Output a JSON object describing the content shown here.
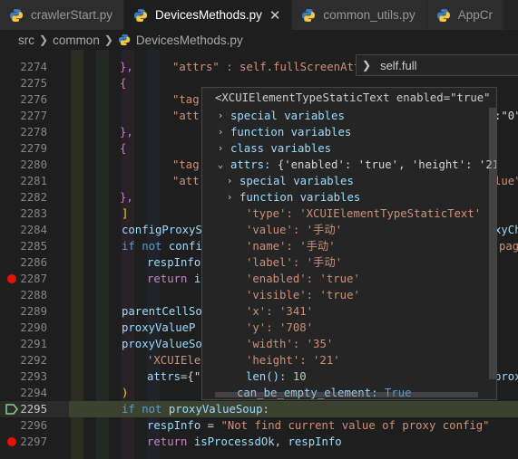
{
  "tabs": [
    {
      "label": "crawlerStart.py",
      "active": false
    },
    {
      "label": "DevicesMethods.py",
      "active": true
    },
    {
      "label": "common_utils.py",
      "active": false
    },
    {
      "label": "AppCr",
      "active": false
    }
  ],
  "close_glyph": "✕",
  "breadcrumb": [
    "src",
    "common",
    "DevicesMethods.py"
  ],
  "lines": [
    {
      "n": "2274",
      "code": [
        [
          "w",
          "},"
        ]
      ]
    },
    {
      "n": "2275",
      "code": [
        [
          "w",
          "{"
        ]
      ]
    },
    {
      "n": "2276",
      "code": [
        [
          "s",
          "\"tag"
        ]
      ]
    },
    {
      "n": "2277",
      "code": [
        [
          "s",
          "\"att"
        ],
        [
          "w",
          ":\"0\""
        ]
      ]
    },
    {
      "n": "2278",
      "code": [
        [
          "w",
          "},"
        ]
      ]
    },
    {
      "n": "2279",
      "code": [
        [
          "w",
          "{"
        ]
      ]
    },
    {
      "n": "2280",
      "code": [
        [
          "s",
          "\"tag"
        ]
      ]
    },
    {
      "n": "2281",
      "code": [
        [
          "s",
          "\"att"
        ],
        [
          "s",
          "lue\""
        ]
      ]
    },
    {
      "n": "2282",
      "code": [
        [
          "w",
          "},"
        ]
      ]
    },
    {
      "n": "2283",
      "code": [
        [
          "w",
          "]"
        ]
      ]
    },
    {
      "n": "2284",
      "code": [
        [
          "v",
          "configProxyS"
        ],
        [
          "v",
          "xyCh"
        ]
      ]
    },
    {
      "n": "2285",
      "code": [
        [
          "k",
          "if"
        ],
        [
          "w",
          " "
        ],
        [
          "k",
          "not"
        ],
        [
          "w",
          " "
        ],
        [
          "v",
          "confi"
        ],
        [
          "s",
          "pag"
        ]
      ]
    },
    {
      "n": "2286",
      "code": [
        [
          "v",
          "respInfo"
        ]
      ]
    },
    {
      "n": "2287",
      "code": [
        [
          "kc",
          "return"
        ],
        [
          "w",
          " "
        ],
        [
          "v",
          "i"
        ]
      ]
    },
    {
      "n": "2288",
      "code": []
    },
    {
      "n": "2289",
      "code": [
        [
          "v",
          "parentCellSo"
        ]
      ]
    },
    {
      "n": "2290",
      "code": [
        [
          "v",
          "proxyValueP"
        ]
      ]
    },
    {
      "n": "2291",
      "code": [
        [
          "v",
          "proxyValueSo"
        ]
      ]
    },
    {
      "n": "2292",
      "code": [
        [
          "s",
          "'XCUIEle"
        ]
      ]
    },
    {
      "n": "2293",
      "code": [
        [
          "v",
          "attrs"
        ],
        [
          "w",
          "={\""
        ],
        [
          "v",
          "prox"
        ]
      ]
    },
    {
      "n": "2294",
      "code": [
        [
          "w",
          ")"
        ]
      ]
    },
    {
      "n": "2295",
      "code": [
        [
          "k",
          "if"
        ],
        [
          "w",
          " "
        ],
        [
          "k",
          "not"
        ],
        [
          "w",
          " "
        ],
        [
          "v",
          "proxyValueSoup"
        ],
        [
          "w",
          ":"
        ]
      ]
    },
    {
      "n": "2296",
      "code": [
        [
          "v",
          "respInfo"
        ],
        [
          "w",
          " = "
        ],
        [
          "s",
          "\"Not find current value of proxy config\""
        ]
      ]
    },
    {
      "n": "2297",
      "code": [
        [
          "kc",
          "return"
        ],
        [
          "w",
          " "
        ],
        [
          "v",
          "isProcessdOk"
        ],
        [
          "w",
          ", "
        ],
        [
          "v",
          "respInfo"
        ]
      ]
    }
  ],
  "first_line_partial": "\"attrs\" : self.fullScreenAtt",
  "hover_title": "self.full",
  "debug_hover": {
    "header": "<XCUIElementTypeStaticText enabled=\"true\" hei…",
    "rows": [
      {
        "twisty": "›",
        "depth": 0,
        "label": "special variables",
        "kind": "group"
      },
      {
        "twisty": "›",
        "depth": 0,
        "label": "function variables",
        "kind": "group"
      },
      {
        "twisty": "›",
        "depth": 0,
        "label": "class variables",
        "kind": "group"
      },
      {
        "twisty": "⌄",
        "depth": 0,
        "label": "attrs:",
        "value": " {'enabled': 'true', 'height': '21', '",
        "kind": "attrs"
      },
      {
        "twisty": "›",
        "depth": 1,
        "label": "special variables",
        "kind": "group"
      },
      {
        "twisty": "›",
        "depth": 1,
        "label": "function variables",
        "kind": "group"
      },
      {
        "twisty": "",
        "depth": 1,
        "label": "'type':",
        "value": " 'XCUIElementTypeStaticText'",
        "kind": "kv"
      },
      {
        "twisty": "",
        "depth": 1,
        "label": "'value':",
        "value": " '手动'",
        "kind": "kv"
      },
      {
        "twisty": "",
        "depth": 1,
        "label": "'name':",
        "value": " '手动'",
        "kind": "kv"
      },
      {
        "twisty": "",
        "depth": 1,
        "label": "'label':",
        "value": " '手动'",
        "kind": "kv"
      },
      {
        "twisty": "",
        "depth": 1,
        "label": "'enabled':",
        "value": " 'true'",
        "kind": "kv"
      },
      {
        "twisty": "",
        "depth": 1,
        "label": "'visible':",
        "value": " 'true'",
        "kind": "kv"
      },
      {
        "twisty": "",
        "depth": 1,
        "label": "'x':",
        "value": " '341'",
        "kind": "kv"
      },
      {
        "twisty": "",
        "depth": 1,
        "label": "'y':",
        "value": " '708'",
        "kind": "kv"
      },
      {
        "twisty": "",
        "depth": 1,
        "label": "'width':",
        "value": " '35'",
        "kind": "kv"
      },
      {
        "twisty": "",
        "depth": 1,
        "label": "'height':",
        "value": " '21'",
        "kind": "kv"
      },
      {
        "twisty": "",
        "depth": 1,
        "label": "len():",
        "value": " 10",
        "kind": "num"
      },
      {
        "twisty": "",
        "depth": 0,
        "label": "can_be_empty_element:",
        "value": " True",
        "kind": "bool"
      }
    ]
  }
}
